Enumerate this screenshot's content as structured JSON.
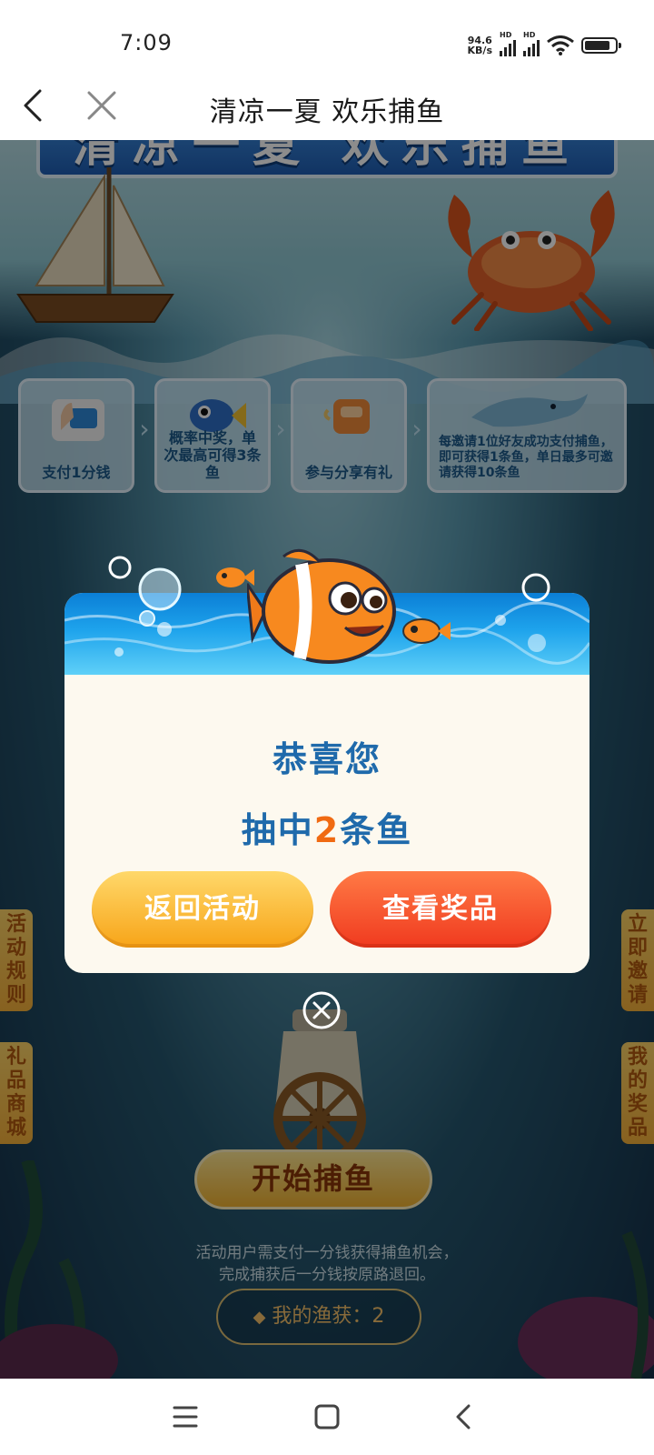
{
  "status_bar": {
    "time": "7:09",
    "net_speed_value": "94.6",
    "net_speed_unit": "KB/s",
    "sim1_label": "HD",
    "sim2_label": "HD",
    "battery_level": 0.84
  },
  "nav": {
    "title": "清凉一夏 欢乐捕鱼"
  },
  "banner": {
    "title": "清凉一夏 欢乐捕鱼"
  },
  "steps": [
    {
      "text": "支付1分钱"
    },
    {
      "text": "概率中奖，单次最高可得3条鱼"
    },
    {
      "text": "参与分享有礼"
    },
    {
      "text": "每邀请1位好友成功支付捕鱼，即可获得1条鱼，单日最多可邀请获得10条鱼"
    }
  ],
  "side_tabs": {
    "rules": "活动规则",
    "mall": "礼品商城",
    "invite": "立即邀请",
    "my_prizes": "我的奖品"
  },
  "start_button": "开始捕鱼",
  "notice": {
    "line1": "活动用户需支付一分钱获得捕鱼机会，",
    "line2": "完成捕获后一分钱按原路退回。"
  },
  "my_catch": {
    "label": "我的渔获：",
    "count": "2"
  },
  "modal": {
    "title": "恭喜您",
    "result_prefix": "抽中",
    "result_count": "2",
    "result_suffix": "条鱼",
    "back_button": "返回活动",
    "prize_button": "查看奖品"
  },
  "colors": {
    "modal_text": "#1f6aab",
    "accent_orange": "#f06a12",
    "back_button": "#f7a418",
    "prize_button": "#f03a1f"
  },
  "icons": {
    "nav_back": "chevron-left-icon",
    "nav_close": "close-icon",
    "modal_close": "close-circle-icon",
    "sys_menu": "menu-icon",
    "sys_home": "home-square-icon",
    "sys_back": "back-triangle-icon"
  }
}
